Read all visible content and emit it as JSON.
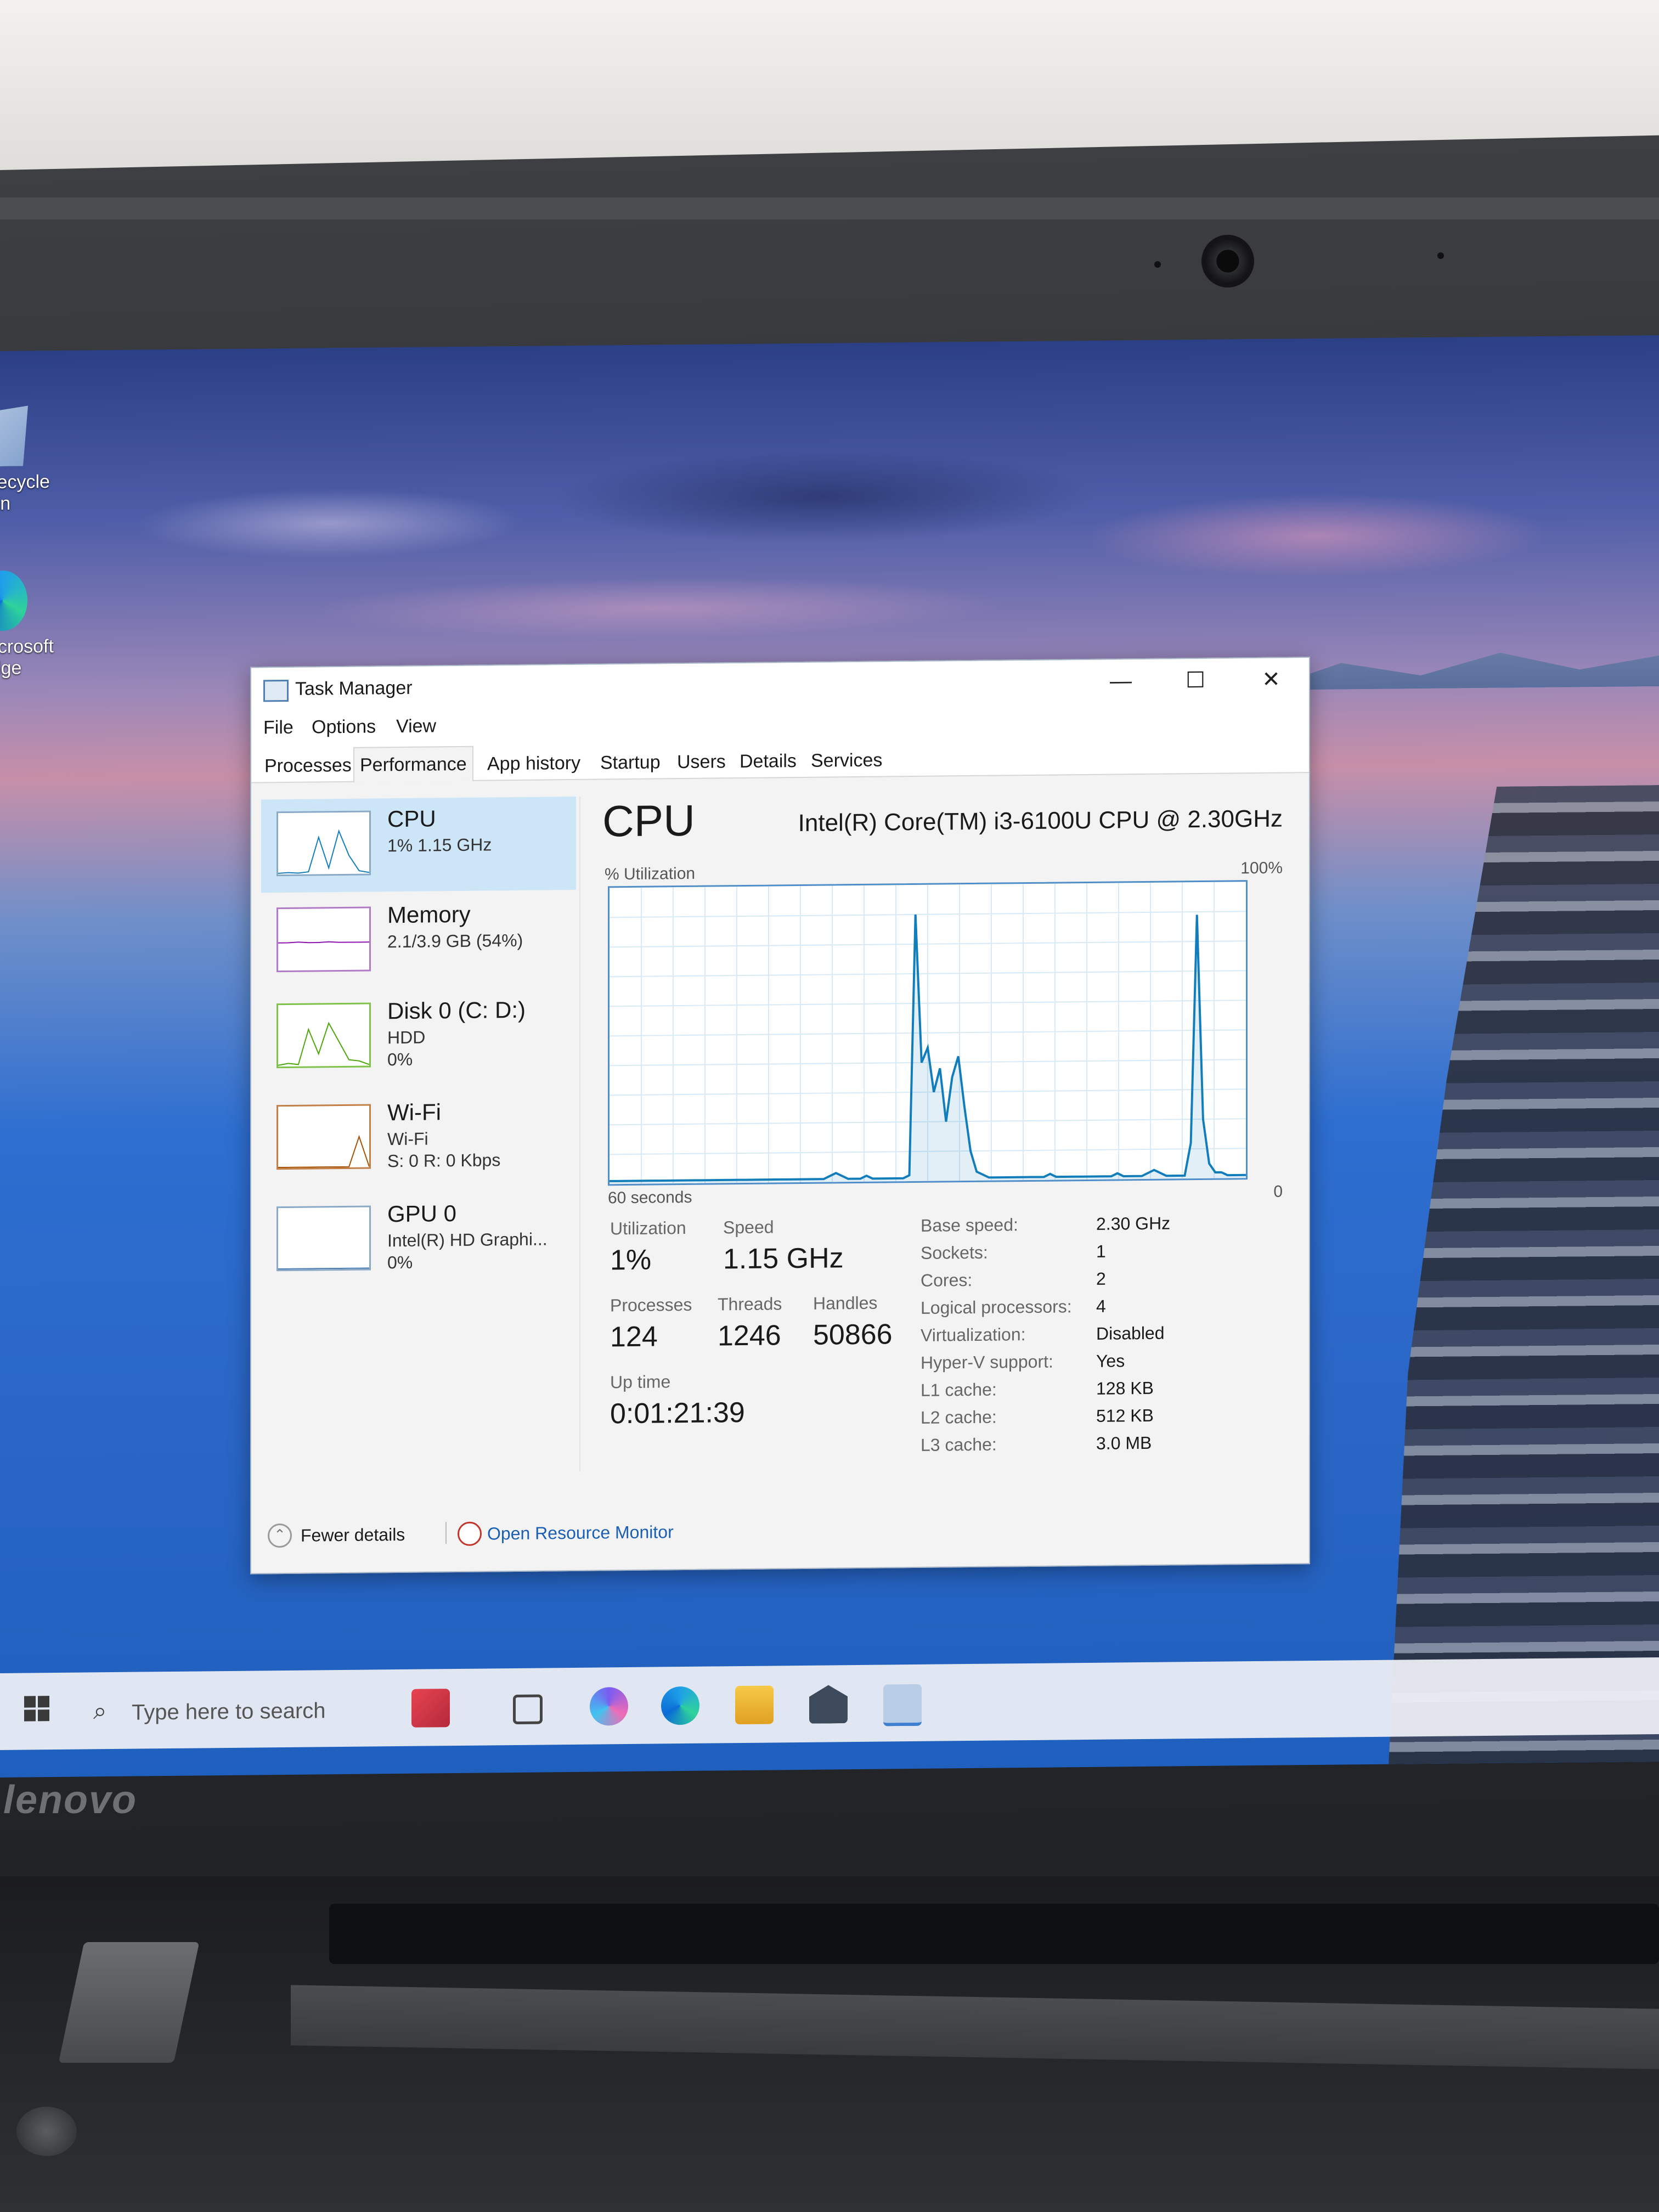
{
  "desktop": {
    "icons": [
      {
        "label": "Recycle Bin"
      },
      {
        "label": "Microsoft Edge"
      }
    ]
  },
  "device": {
    "brand": "lenovo"
  },
  "window": {
    "title": "Task Manager",
    "controls": {
      "minimize": "—",
      "maximize": "☐",
      "close": "✕"
    }
  },
  "menu": [
    "File",
    "Options",
    "View"
  ],
  "tabs": [
    {
      "label": "Processes",
      "active": false
    },
    {
      "label": "Performance",
      "active": true
    },
    {
      "label": "App history",
      "active": false
    },
    {
      "label": "Startup",
      "active": false
    },
    {
      "label": "Users",
      "active": false
    },
    {
      "label": "Details",
      "active": false
    },
    {
      "label": "Services",
      "active": false
    }
  ],
  "sidebar": [
    {
      "name": "CPU",
      "line1": "1% 1.15 GHz",
      "line2": "",
      "color": "#117dbb",
      "selected": true
    },
    {
      "name": "Memory",
      "line1": "2.1/3.9 GB (54%)",
      "line2": "",
      "color": "#8b12ae",
      "selected": false
    },
    {
      "name": "Disk 0 (C: D:)",
      "line1": "HDD",
      "line2": "0%",
      "color": "#4da60c",
      "selected": false
    },
    {
      "name": "Wi-Fi",
      "line1": "Wi-Fi",
      "line2": "S: 0 R: 0 Kbps",
      "color": "#a74f01",
      "selected": false
    },
    {
      "name": "GPU 0",
      "line1": "Intel(R) HD Graphi...",
      "line2": "0%",
      "color": "#4a7bb3",
      "selected": false
    }
  ],
  "cpu": {
    "heading": "CPU",
    "model": "Intel(R) Core(TM) i3-6100U CPU @ 2.30GHz",
    "graph_label": "% Utilization",
    "graph_max": "100%",
    "graph_time": "60 seconds",
    "graph_min": "0",
    "utilization_history": [
      1,
      1,
      1,
      1,
      1,
      1,
      1,
      1,
      1,
      1,
      1,
      1,
      1,
      1,
      1,
      1,
      1,
      1,
      1,
      1,
      1,
      1,
      1,
      1,
      1,
      1,
      1,
      1,
      1,
      1,
      1,
      1,
      1,
      1,
      1,
      1,
      2,
      3,
      2,
      1,
      1,
      1,
      2,
      1,
      1,
      1,
      1,
      1,
      1,
      2,
      90,
      40,
      45,
      30,
      38,
      20,
      35,
      42,
      25,
      10,
      3,
      2,
      1,
      1,
      1,
      1,
      1,
      1,
      1,
      1,
      1,
      1,
      2,
      1,
      1,
      1,
      1,
      1,
      1,
      1,
      1,
      1,
      1,
      2,
      1,
      1,
      1,
      1,
      2,
      3,
      2,
      1,
      1,
      1,
      1,
      12,
      89,
      20,
      5,
      2,
      2,
      1,
      1,
      1,
      1
    ],
    "stats": {
      "utilization_label": "Utilization",
      "utilization": "1%",
      "speed_label": "Speed",
      "speed": "1.15 GHz",
      "processes_label": "Processes",
      "processes": "124",
      "threads_label": "Threads",
      "threads": "1246",
      "handles_label": "Handles",
      "handles": "50866",
      "uptime_label": "Up time",
      "uptime": "0:01:21:39"
    },
    "specs": [
      {
        "label": "Base speed:",
        "value": "2.30 GHz"
      },
      {
        "label": "Sockets:",
        "value": "1"
      },
      {
        "label": "Cores:",
        "value": "2"
      },
      {
        "label": "Logical processors:",
        "value": "4"
      },
      {
        "label": "Virtualization:",
        "value": "Disabled"
      },
      {
        "label": "Hyper-V support:",
        "value": "Yes"
      },
      {
        "label": "L1 cache:",
        "value": "128 KB"
      },
      {
        "label": "L2 cache:",
        "value": "512 KB"
      },
      {
        "label": "L3 cache:",
        "value": "3.0 MB"
      }
    ]
  },
  "footer": {
    "fewer_details": "Fewer details",
    "open_resource_monitor": "Open Resource Monitor"
  },
  "taskbar": {
    "search_placeholder": "Type here to search"
  }
}
